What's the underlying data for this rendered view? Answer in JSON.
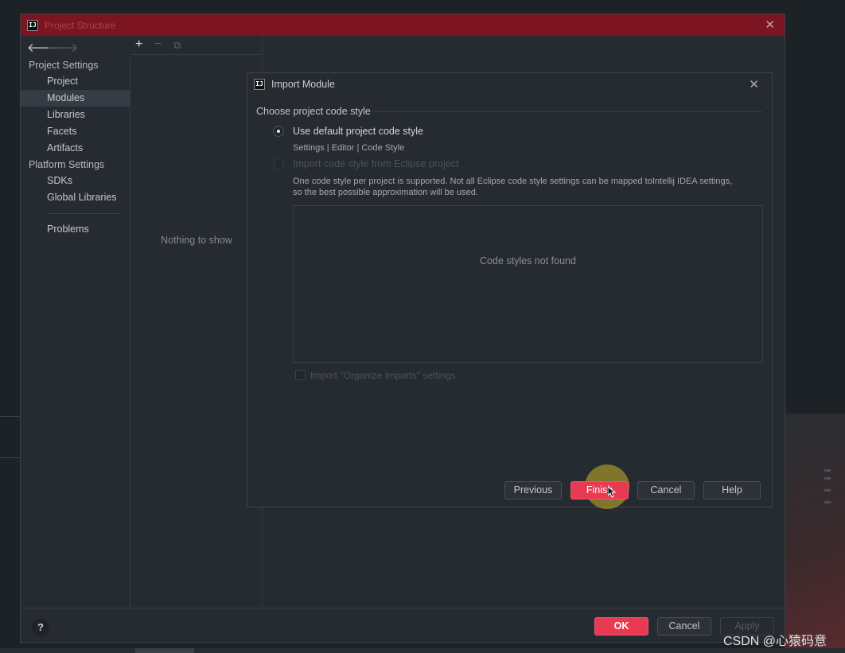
{
  "window": {
    "title": "Project Structure",
    "app_icon_text": "IJ"
  },
  "nav": {
    "back_icon": "arrow-left-icon",
    "forward_icon": "arrow-right-icon"
  },
  "sidebar": {
    "project_settings_header": "Project Settings",
    "project_items": [
      {
        "label": "Project"
      },
      {
        "label": "Modules",
        "selected": true
      },
      {
        "label": "Libraries"
      },
      {
        "label": "Facets"
      },
      {
        "label": "Artifacts"
      }
    ],
    "platform_settings_header": "Platform Settings",
    "platform_items": [
      {
        "label": "SDKs"
      },
      {
        "label": "Global Libraries"
      }
    ],
    "problems": "Problems"
  },
  "modules_panel": {
    "empty_text": "Nothing to show"
  },
  "dialog": {
    "title": "Import Module",
    "section_label": "Choose project code style",
    "option_default": "Use default project code style",
    "option_default_hint": "Settings | Editor | Code Style",
    "option_eclipse": "Import code style from Eclipse project",
    "description_line1": "One code style per project is supported. Not all Eclipse code style settings can be mapped toIntellij IDEA settings,",
    "description_line2": "so the best possible approximation will be used.",
    "styles_empty": "Code styles not found",
    "checkbox_label": "Import \"Organize Imports\" settings",
    "buttons": {
      "previous": "Previous",
      "finish": "Finish",
      "cancel": "Cancel",
      "help": "Help"
    }
  },
  "footer": {
    "help": "?",
    "ok": "OK",
    "cancel": "Cancel",
    "apply": "Apply"
  },
  "watermark": "CSDN @心猿码意",
  "colors": {
    "title_bar": "#7d1422",
    "primary_button": "#e83a52",
    "background": "#262b31"
  }
}
